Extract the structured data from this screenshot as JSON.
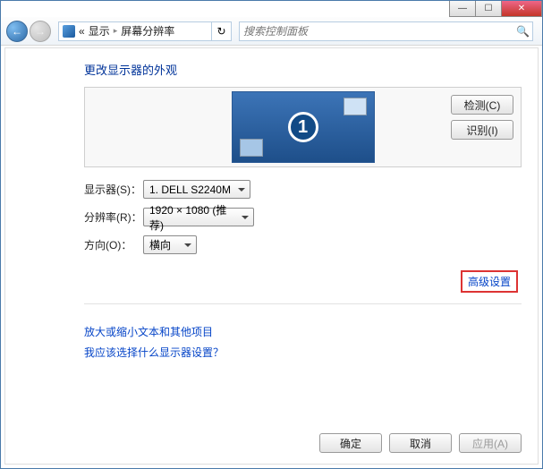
{
  "titlebar": {
    "min_glyph": "—",
    "max_glyph": "☐",
    "close_glyph": "✕"
  },
  "nav": {
    "back_glyph": "←",
    "fwd_glyph": "→",
    "sep_glyph": "▸",
    "crumb1": "显示",
    "crumb2": "屏幕分辨率",
    "refresh_glyph": "↻",
    "search_placeholder": "搜索控制面板",
    "search_glyph": "🔍"
  },
  "heading": "更改显示器的外观",
  "monitor_number": "1",
  "side_buttons": {
    "detect": "检测(C)",
    "identify": "识别(I)"
  },
  "fields": {
    "display_label": "显示器(S)：",
    "display_value": "1. DELL S2240M",
    "resolution_label": "分辨率(R)：",
    "resolution_value": "1920 × 1080 (推荐)",
    "orientation_label": "方向(O)：",
    "orientation_value": "横向"
  },
  "advanced_link": "高级设置",
  "links": {
    "text_size": "放大或缩小文本和其他项目",
    "which_display": "我应该选择什么显示器设置？"
  },
  "footer": {
    "ok": "确定",
    "cancel": "取消",
    "apply": "应用(A)"
  }
}
